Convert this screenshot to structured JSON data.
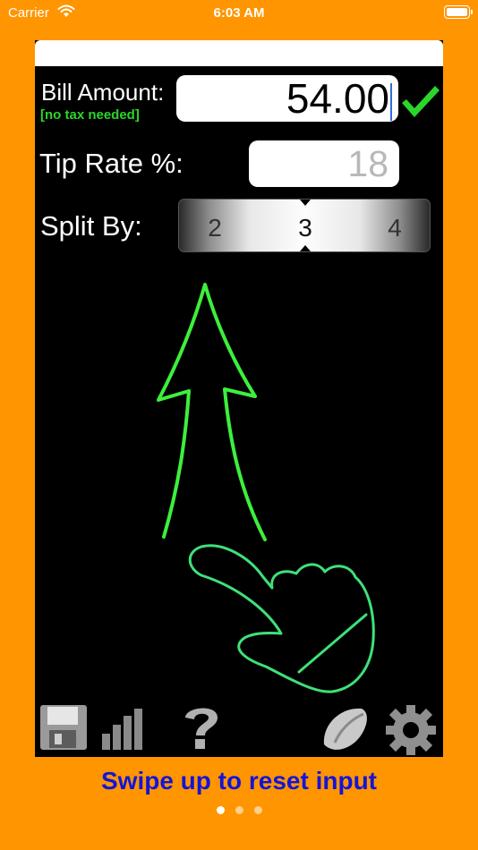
{
  "status_bar": {
    "carrier": "Carrier",
    "time": "6:03 AM"
  },
  "form": {
    "bill_label": "Bill Amount:",
    "tax_note": "[no tax needed]",
    "bill_value": "54.00",
    "tip_label": "Tip Rate %:",
    "tip_placeholder": "18",
    "split_label": "Split By:",
    "split_options": [
      "2",
      "3",
      "4"
    ],
    "split_selected": "3"
  },
  "colors": {
    "background": "#FF9500",
    "accent_green": "#2BD52B",
    "hint_text": "#1414D8"
  },
  "toolbar": {
    "left_icons": [
      "save-icon",
      "stats-icon",
      "help-icon"
    ],
    "right_icons": [
      "fortune-cookie-icon",
      "settings-gear-icon"
    ]
  },
  "hint": "Swipe up to reset input",
  "pager": {
    "count": 3,
    "active_index": 0
  }
}
